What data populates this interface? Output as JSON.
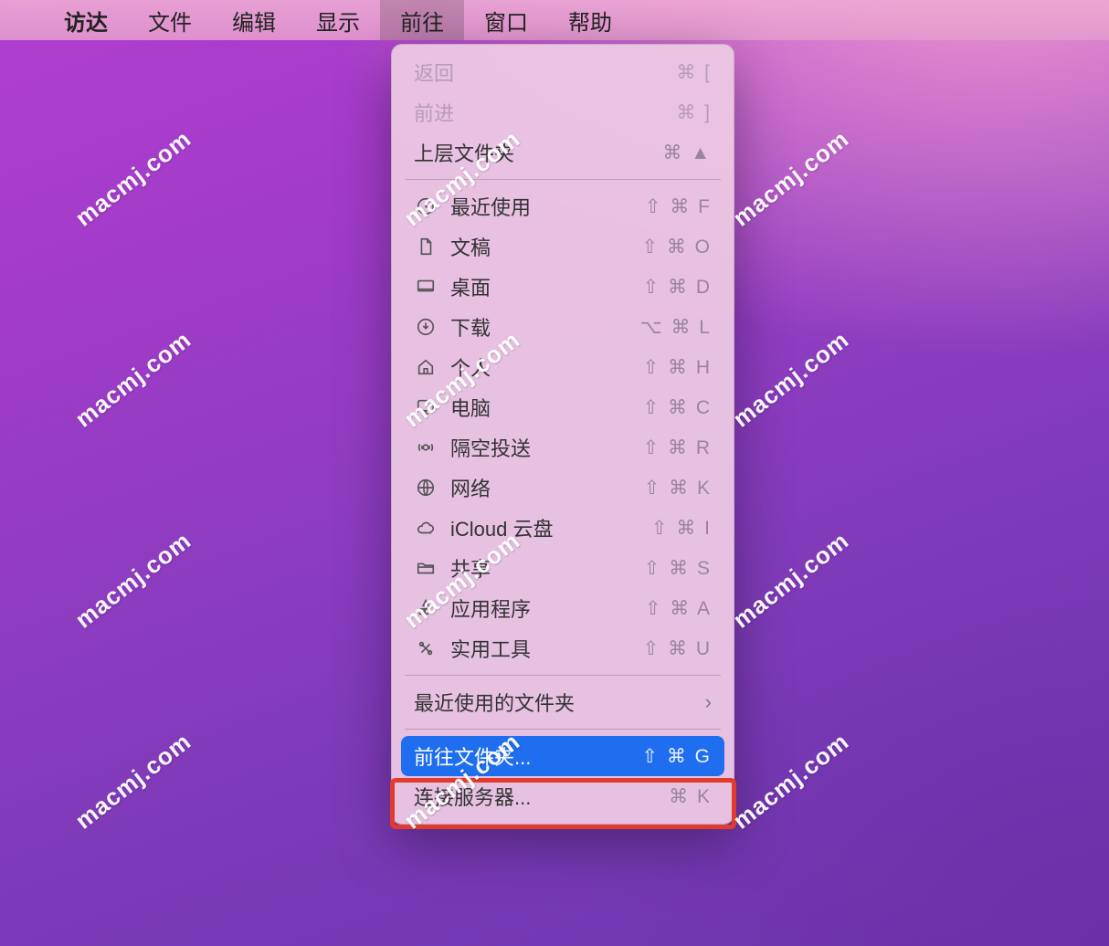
{
  "watermark": "macmj.com",
  "menubar": {
    "app": "访达",
    "items": [
      "文件",
      "编辑",
      "显示",
      "前往",
      "窗口",
      "帮助"
    ],
    "active_index": 3
  },
  "dropdown": {
    "group_nav": [
      {
        "label": "返回",
        "shortcut": "⌘ [",
        "disabled": true
      },
      {
        "label": "前进",
        "shortcut": "⌘ ]",
        "disabled": true
      },
      {
        "label": "上层文件夹",
        "shortcut": "⌘ ▲",
        "disabled": false
      }
    ],
    "group_places": [
      {
        "icon": "clock",
        "label": "最近使用",
        "shortcut": "⇧ ⌘ F"
      },
      {
        "icon": "doc",
        "label": "文稿",
        "shortcut": "⇧ ⌘ O"
      },
      {
        "icon": "desktop",
        "label": "桌面",
        "shortcut": "⇧ ⌘ D"
      },
      {
        "icon": "download",
        "label": "下载",
        "shortcut": "⌥ ⌘ L"
      },
      {
        "icon": "home",
        "label": "个人",
        "shortcut": "⇧ ⌘ H"
      },
      {
        "icon": "display",
        "label": "电脑",
        "shortcut": "⇧ ⌘ C"
      },
      {
        "icon": "airdrop",
        "label": "隔空投送",
        "shortcut": "⇧ ⌘ R"
      },
      {
        "icon": "globe",
        "label": "网络",
        "shortcut": "⇧ ⌘ K"
      },
      {
        "icon": "cloud",
        "label": "iCloud 云盘",
        "shortcut": "⇧ ⌘ I"
      },
      {
        "icon": "folder",
        "label": "共享",
        "shortcut": "⇧ ⌘ S"
      },
      {
        "icon": "apps",
        "label": "应用程序",
        "shortcut": "⇧ ⌘ A"
      },
      {
        "icon": "utilities",
        "label": "实用工具",
        "shortcut": "⇧ ⌘ U"
      }
    ],
    "recent_folders": {
      "label": "最近使用的文件夹"
    },
    "go_to_folder": {
      "label": "前往文件夹...",
      "shortcut": "⇧ ⌘ G"
    },
    "connect_server": {
      "label": "连接服务器...",
      "shortcut": "⌘ K"
    }
  }
}
